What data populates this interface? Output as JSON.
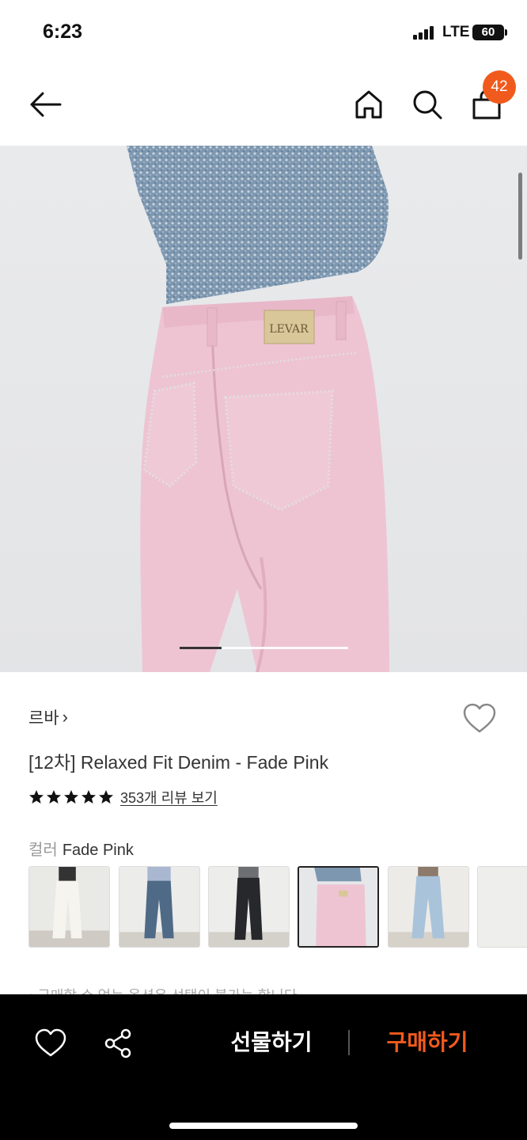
{
  "status_bar": {
    "time": "6:23",
    "network": "LTE",
    "battery": "60"
  },
  "header": {
    "cart_count": "42"
  },
  "gallery": {
    "image_alt": "Product photo: pink relaxed fit denim jeans with LEVAR leather patch",
    "label_text": "LEVAR",
    "current_page": 1,
    "page_count": 4
  },
  "product": {
    "brand": "르바",
    "brand_chevron": "›",
    "title": "[12차] Relaxed Fit Denim - Fade Pink",
    "rating_stars": 5,
    "review_link": "353개 리뷰 보기",
    "color_label": "컬러",
    "color_value": "Fade Pink"
  },
  "swatches": [
    {
      "name": "White",
      "color": "#f2f0ea",
      "selected": false
    },
    {
      "name": "Mid Blue",
      "color": "#5b7690",
      "selected": false
    },
    {
      "name": "Black",
      "color": "#2a2c30",
      "selected": false
    },
    {
      "name": "Fade Pink",
      "color": "#efc9d6",
      "selected": true
    },
    {
      "name": "Light Blue",
      "color": "#a9c3da",
      "selected": false
    }
  ],
  "notice": "• 구매할 수 없는 옵션은 선택이 불가능 합니다",
  "bottom_bar": {
    "gift_label": "선물하기",
    "buy_label": "구매하기"
  },
  "colors": {
    "accent": "#f15a1d",
    "bottom_bar_bg": "#000000"
  }
}
